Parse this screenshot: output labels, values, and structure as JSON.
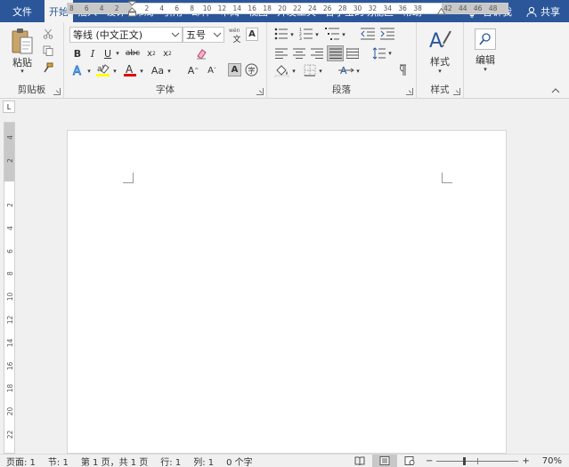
{
  "tabs": [
    {
      "label": "文件",
      "active": false
    },
    {
      "label": "开始",
      "active": true
    },
    {
      "label": "插入",
      "active": false
    },
    {
      "label": "设计",
      "active": false
    },
    {
      "label": "布局",
      "active": false
    },
    {
      "label": "引用",
      "active": false
    },
    {
      "label": "邮件",
      "active": false
    },
    {
      "label": "审阅",
      "active": false
    },
    {
      "label": "视图",
      "active": false
    },
    {
      "label": "开发工具",
      "active": false
    },
    {
      "label": "曹小宝的功能区",
      "active": false
    },
    {
      "label": "帮助",
      "active": false
    }
  ],
  "tell_me": "告诉我",
  "share": "共享",
  "groups": {
    "clipboard": {
      "label": "剪贴板",
      "paste": "粘贴"
    },
    "font": {
      "label": "字体",
      "font_name": "等线 (中文正文)",
      "font_size": "五号",
      "wen": "文"
    },
    "paragraph": {
      "label": "段落"
    },
    "styles": {
      "label": "样式",
      "styles_btn": "样式"
    },
    "editing": {
      "label": "编辑",
      "editing_btn": "编辑"
    }
  },
  "ruler": {
    "h_left": [
      "8",
      "6",
      "4",
      "2"
    ],
    "h_right": [
      "2",
      "4",
      "6",
      "8",
      "10",
      "12",
      "14",
      "16",
      "18",
      "20",
      "22",
      "24",
      "26",
      "28",
      "30",
      "32",
      "34",
      "36",
      "38"
    ],
    "h_far": [
      "42",
      "44",
      "46",
      "48"
    ],
    "v_top": [
      "4",
      "2"
    ],
    "v_body": [
      "2",
      "4",
      "6",
      "8",
      "10",
      "12",
      "14",
      "16",
      "18",
      "20",
      "22"
    ]
  },
  "status": {
    "page": "页面: 1",
    "section": "节: 1",
    "pages": "第 1 页，共 1 页",
    "line": "行: 1",
    "column": "列: 1",
    "chars": "0 个字",
    "zoom_minus": "−",
    "zoom_plus": "+",
    "zoom": "70%"
  },
  "colors": {
    "ribbon_blue": "#2b579a",
    "highlight": "#ffff00",
    "font_color": "#e00000"
  }
}
